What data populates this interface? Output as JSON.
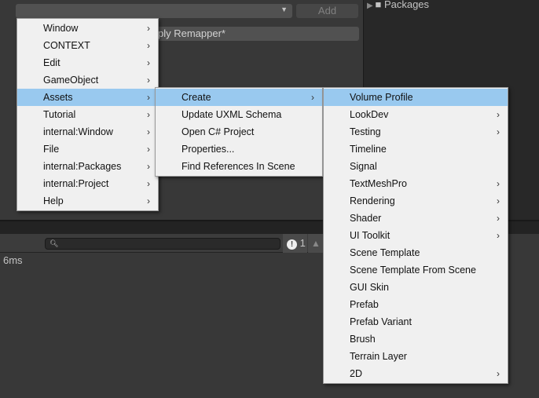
{
  "top": {
    "add_label": "Add",
    "field_value": "ply Remapper*",
    "packages_label": "Packages"
  },
  "console": {
    "error_count": "1",
    "log_text": "6ms"
  },
  "menu1": [
    {
      "label": "Window",
      "sub": true
    },
    {
      "label": "CONTEXT",
      "sub": true
    },
    {
      "label": "Edit",
      "sub": true
    },
    {
      "label": "GameObject",
      "sub": true
    },
    {
      "label": "Assets",
      "sub": true
    },
    {
      "label": "Tutorial",
      "sub": true
    },
    {
      "label": "internal:Window",
      "sub": true
    },
    {
      "label": "File",
      "sub": true
    },
    {
      "label": "internal:Packages",
      "sub": true
    },
    {
      "label": "internal:Project",
      "sub": true
    },
    {
      "label": "Help",
      "sub": true
    }
  ],
  "menu2": [
    {
      "label": "Create",
      "sub": true
    },
    {
      "label": "Update UXML Schema"
    },
    {
      "label": "Open C# Project"
    },
    {
      "label": "Properties..."
    },
    {
      "label": "Find References In Scene"
    }
  ],
  "menu3": [
    {
      "label": "Volume Profile"
    },
    {
      "label": "LookDev",
      "sub": true
    },
    {
      "label": "Testing",
      "sub": true
    },
    {
      "label": "Timeline"
    },
    {
      "label": "Signal"
    },
    {
      "label": "TextMeshPro",
      "sub": true
    },
    {
      "label": "Rendering",
      "sub": true
    },
    {
      "label": "Shader",
      "sub": true
    },
    {
      "label": "UI Toolkit",
      "sub": true
    },
    {
      "label": "Scene Template"
    },
    {
      "label": "Scene Template From Scene"
    },
    {
      "label": "GUI Skin"
    },
    {
      "label": "Prefab"
    },
    {
      "label": "Prefab Variant"
    },
    {
      "label": "Brush"
    },
    {
      "label": "Terrain Layer"
    },
    {
      "label": "2D",
      "sub": true
    }
  ],
  "highlighted": {
    "menu1": "Assets",
    "menu2": "Create",
    "menu3": "Volume Profile"
  },
  "colors": {
    "highlight": "#99c9ef",
    "menu_bg": "#f0f0f0"
  }
}
